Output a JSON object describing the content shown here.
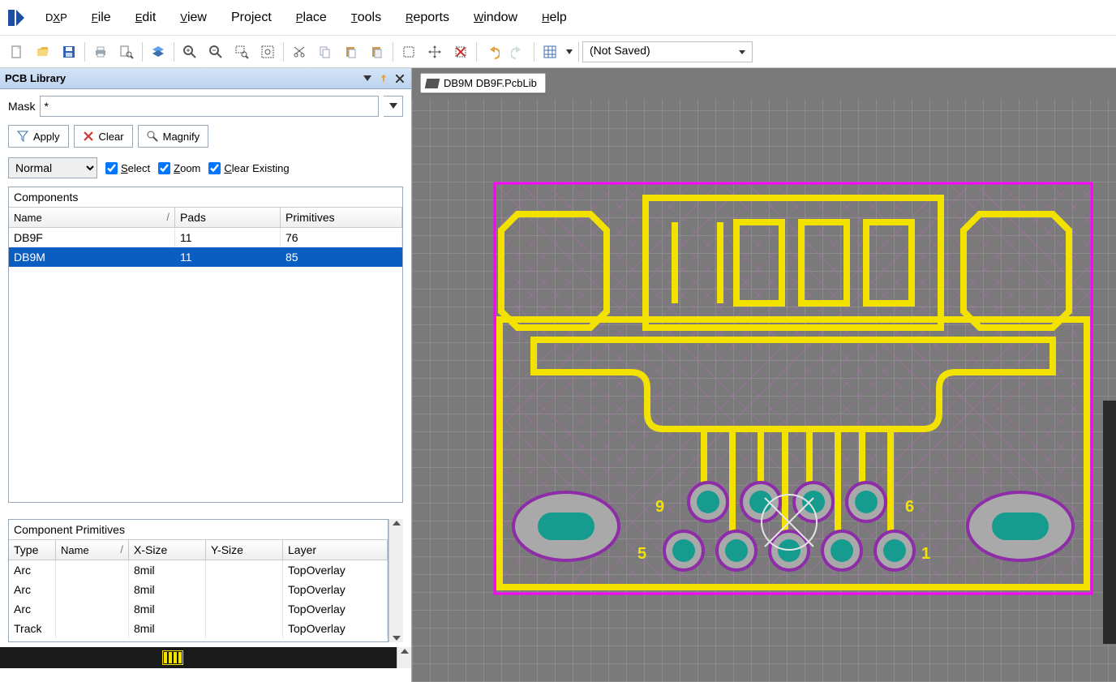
{
  "app": {
    "name": "DXP"
  },
  "menu": {
    "file": "File",
    "edit": "Edit",
    "view": "View",
    "project": "Project",
    "place": "Place",
    "tools": "Tools",
    "reports": "Reports",
    "window": "Window",
    "help": "Help"
  },
  "toolbar": {
    "combo": "(Not Saved)"
  },
  "panel": {
    "title": "PCB Library",
    "mask_label": "Mask",
    "mask_value": "*",
    "apply": "Apply",
    "clear": "Clear",
    "magnify": "Magnify",
    "mode": "Normal",
    "chk_select": "Select",
    "chk_zoom": "Zoom",
    "chk_clear": "Clear Existing"
  },
  "components": {
    "title": "Components",
    "cols": {
      "name": "Name",
      "pads": "Pads",
      "primitives": "Primitives"
    },
    "rows": [
      {
        "name": "DB9F",
        "pads": "11",
        "primitives": "76"
      },
      {
        "name": "DB9M",
        "pads": "11",
        "primitives": "85"
      }
    ],
    "selected": 1
  },
  "primitives": {
    "title": "Component Primitives",
    "cols": {
      "type": "Type",
      "name": "Name",
      "xsize": "X-Size",
      "ysize": "Y-Size",
      "layer": "Layer"
    },
    "rows": [
      {
        "type": "Arc",
        "name": "",
        "xsize": "8mil",
        "ysize": "",
        "layer": "TopOverlay"
      },
      {
        "type": "Arc",
        "name": "",
        "xsize": "8mil",
        "ysize": "",
        "layer": "TopOverlay"
      },
      {
        "type": "Arc",
        "name": "",
        "xsize": "8mil",
        "ysize": "",
        "layer": "TopOverlay"
      },
      {
        "type": "Track",
        "name": "",
        "xsize": "8mil",
        "ysize": "",
        "layer": "TopOverlay"
      }
    ]
  },
  "document": {
    "tab": "DB9M DB9F.PcbLib"
  },
  "labels": {
    "p9": "9",
    "p6": "6",
    "p5": "5",
    "p1": "1"
  }
}
